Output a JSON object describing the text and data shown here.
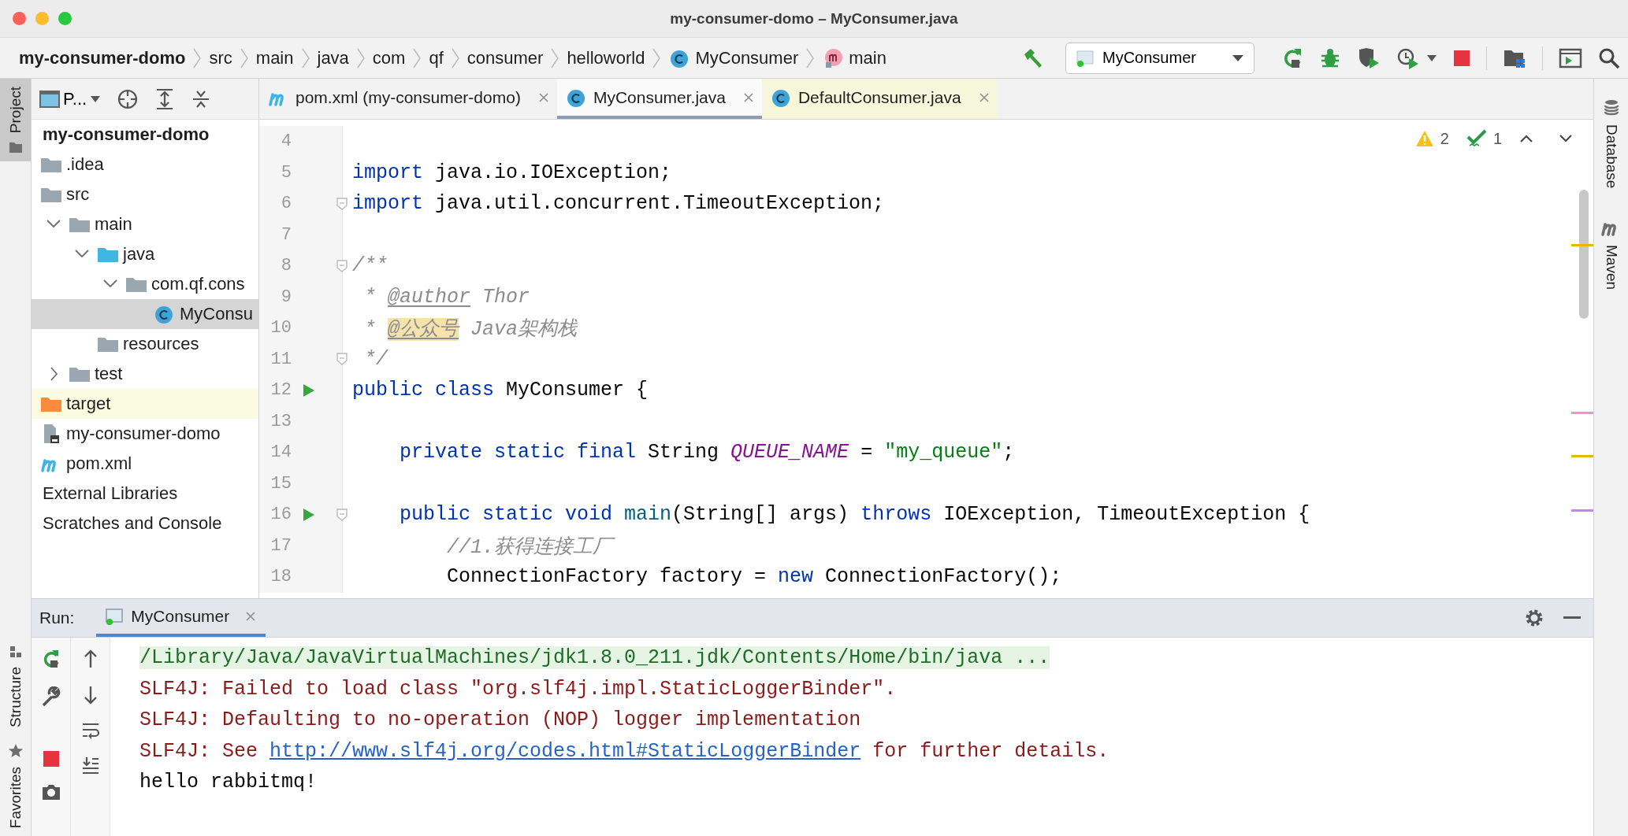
{
  "window": {
    "title": "my-consumer-domo – MyConsumer.java"
  },
  "breadcrumbs": [
    {
      "label": "my-consumer-domo",
      "kind": "project"
    },
    {
      "label": "src",
      "kind": "folder"
    },
    {
      "label": "main",
      "kind": "folder"
    },
    {
      "label": "java",
      "kind": "folder"
    },
    {
      "label": "com",
      "kind": "folder"
    },
    {
      "label": "qf",
      "kind": "folder"
    },
    {
      "label": "consumer",
      "kind": "folder"
    },
    {
      "label": "helloworld",
      "kind": "folder"
    },
    {
      "label": "MyConsumer",
      "kind": "class"
    },
    {
      "label": "main",
      "kind": "method"
    }
  ],
  "toolbar": {
    "run_configuration": "MyConsumer"
  },
  "left_stripe_top": [
    {
      "label": "Project",
      "selected": true
    }
  ],
  "left_stripe_bottom": [
    {
      "label": "Structure",
      "selected": false
    },
    {
      "label": "Favorites",
      "selected": false
    }
  ],
  "right_stripe": [
    {
      "label": "Database",
      "kind": "database"
    },
    {
      "label": "Maven",
      "kind": "maven"
    }
  ],
  "project_panel": {
    "view": "P...",
    "tree": [
      {
        "label": "my-consumer-domo",
        "kind": "module",
        "selected": false,
        "children": [
          {
            "label": ".idea",
            "kind": "folder",
            "selected": false
          },
          {
            "label": "src",
            "kind": "folder",
            "selected": false,
            "children": [
              {
                "label": "main",
                "kind": "folder",
                "expanded": true,
                "selected": false,
                "children": [
                  {
                    "label": "java",
                    "kind": "source-root",
                    "expanded": true,
                    "selected": false,
                    "children": [
                      {
                        "label": "com.qf.cons",
                        "kind": "package",
                        "expanded": true,
                        "selected": false,
                        "children": [
                          {
                            "label": "MyConsu",
                            "kind": "class",
                            "selected": true
                          }
                        ]
                      }
                    ]
                  },
                  {
                    "label": "resources",
                    "kind": "resources",
                    "selected": false
                  }
                ]
              },
              {
                "label": "test",
                "kind": "folder",
                "expanded": false,
                "selected": false
              }
            ]
          },
          {
            "label": "target",
            "kind": "excluded",
            "selected": false
          },
          {
            "label": "my-consumer-domo",
            "kind": "iml",
            "selected": false
          },
          {
            "label": "pom.xml",
            "kind": "maven",
            "selected": false
          }
        ]
      },
      {
        "label": "External Libraries",
        "kind": "library",
        "selected": false
      },
      {
        "label": "Scratches and Console",
        "kind": "scratches",
        "selected": false
      }
    ]
  },
  "editor_tabs": [
    {
      "label": "pom.xml (my-consumer-domo)",
      "kind": "maven",
      "selected": false,
      "highlighted": false
    },
    {
      "label": "MyConsumer.java",
      "kind": "class",
      "selected": true,
      "highlighted": false
    },
    {
      "label": "DefaultConsumer.java",
      "kind": "library-class",
      "selected": false,
      "highlighted": true
    }
  ],
  "editor": {
    "warnings": "2",
    "weak_warnings": "1",
    "lines": [
      {
        "number": "4",
        "run_marker": false,
        "fold": false
      },
      {
        "number": "5",
        "run_marker": false,
        "fold": false,
        "tokens": [
          {
            "text": "import",
            "kind": "keyword"
          },
          {
            "text": " java.io.IOException;",
            "kind": "plain"
          }
        ]
      },
      {
        "number": "6",
        "run_marker": false,
        "fold": true,
        "tokens": [
          {
            "text": "import",
            "kind": "keyword"
          },
          {
            "text": " java.util.concurrent.TimeoutException;",
            "kind": "plain"
          }
        ]
      },
      {
        "number": "7",
        "run_marker": false,
        "fold": false
      },
      {
        "number": "8",
        "run_marker": false,
        "fold": true,
        "tokens": [
          {
            "text": "/**",
            "kind": "comment"
          }
        ]
      },
      {
        "number": "9",
        "run_marker": false,
        "fold": false,
        "tokens": [
          {
            "text": " * ",
            "kind": "comment"
          },
          {
            "text": "@author",
            "kind": "doctag"
          },
          {
            "text": " Thor",
            "kind": "comment"
          }
        ]
      },
      {
        "number": "10",
        "run_marker": false,
        "fold": false,
        "tokens": [
          {
            "text": " * ",
            "kind": "comment"
          },
          {
            "text": "@公众号",
            "kind": "doctag-highlighted"
          },
          {
            "text": " Java架构栈",
            "kind": "comment"
          }
        ]
      },
      {
        "number": "11",
        "run_marker": false,
        "fold": true,
        "tokens": [
          {
            "text": " */",
            "kind": "comment"
          }
        ]
      },
      {
        "number": "12",
        "run_marker": true,
        "fold": false,
        "tokens": [
          {
            "text": "public class",
            "kind": "keyword"
          },
          {
            "text": " MyConsumer {",
            "kind": "plain"
          }
        ]
      },
      {
        "number": "13",
        "run_marker": false,
        "fold": false
      },
      {
        "number": "14",
        "run_marker": false,
        "fold": false,
        "tokens": [
          {
            "text": "    private static final",
            "kind": "keyword"
          },
          {
            "text": " String ",
            "kind": "plain"
          },
          {
            "text": "QUEUE_NAME",
            "kind": "field"
          },
          {
            "text": " = ",
            "kind": "plain"
          },
          {
            "text": "\"my_queue\"",
            "kind": "string"
          },
          {
            "text": ";",
            "kind": "plain"
          }
        ]
      },
      {
        "number": "15",
        "run_marker": false,
        "fold": false
      },
      {
        "number": "16",
        "run_marker": true,
        "fold": true,
        "tokens": [
          {
            "text": "    public static void ",
            "kind": "keyword"
          },
          {
            "text": "main",
            "kind": "method"
          },
          {
            "text": "(String[] args) ",
            "kind": "plain"
          },
          {
            "text": "throws",
            "kind": "keyword"
          },
          {
            "text": " IOException, TimeoutException {",
            "kind": "plain"
          }
        ]
      },
      {
        "number": "17",
        "run_marker": false,
        "fold": false,
        "tokens": [
          {
            "text": "        //1.获得连接工厂",
            "kind": "comment"
          }
        ]
      },
      {
        "number": "18",
        "run_marker": false,
        "fold": false,
        "tokens": [
          {
            "text": "        ConnectionFactory factory = ",
            "kind": "plain"
          },
          {
            "text": "new",
            "kind": "keyword"
          },
          {
            "text": " ConnectionFactory();",
            "kind": "plain"
          }
        ]
      }
    ]
  },
  "run_panel": {
    "title": "Run:",
    "tabs": [
      {
        "label": "MyConsumer",
        "selected": true
      }
    ],
    "console": [
      {
        "kind": "command",
        "tokens": [
          {
            "text": "/Library/Java/JavaVirtualMachines/jdk1.8.0_211.jdk/Contents/Home/bin/java ...",
            "kind": "plain"
          }
        ]
      },
      {
        "kind": "error",
        "tokens": [
          {
            "text": "SLF4J: Failed to load class \"org.slf4j.impl.StaticLoggerBinder\".",
            "kind": "plain"
          }
        ]
      },
      {
        "kind": "error",
        "tokens": [
          {
            "text": "SLF4J: Defaulting to no-operation (NOP) logger implementation",
            "kind": "plain"
          }
        ]
      },
      {
        "kind": "error",
        "tokens": [
          {
            "text": "SLF4J: See ",
            "kind": "plain"
          },
          {
            "text": "http://www.slf4j.org/codes.html#StaticLoggerBinder",
            "kind": "link"
          },
          {
            "text": " for further details.",
            "kind": "plain"
          }
        ]
      },
      {
        "kind": "output",
        "tokens": [
          {
            "text": "hello rabbitmq!",
            "kind": "plain"
          }
        ]
      }
    ]
  }
}
